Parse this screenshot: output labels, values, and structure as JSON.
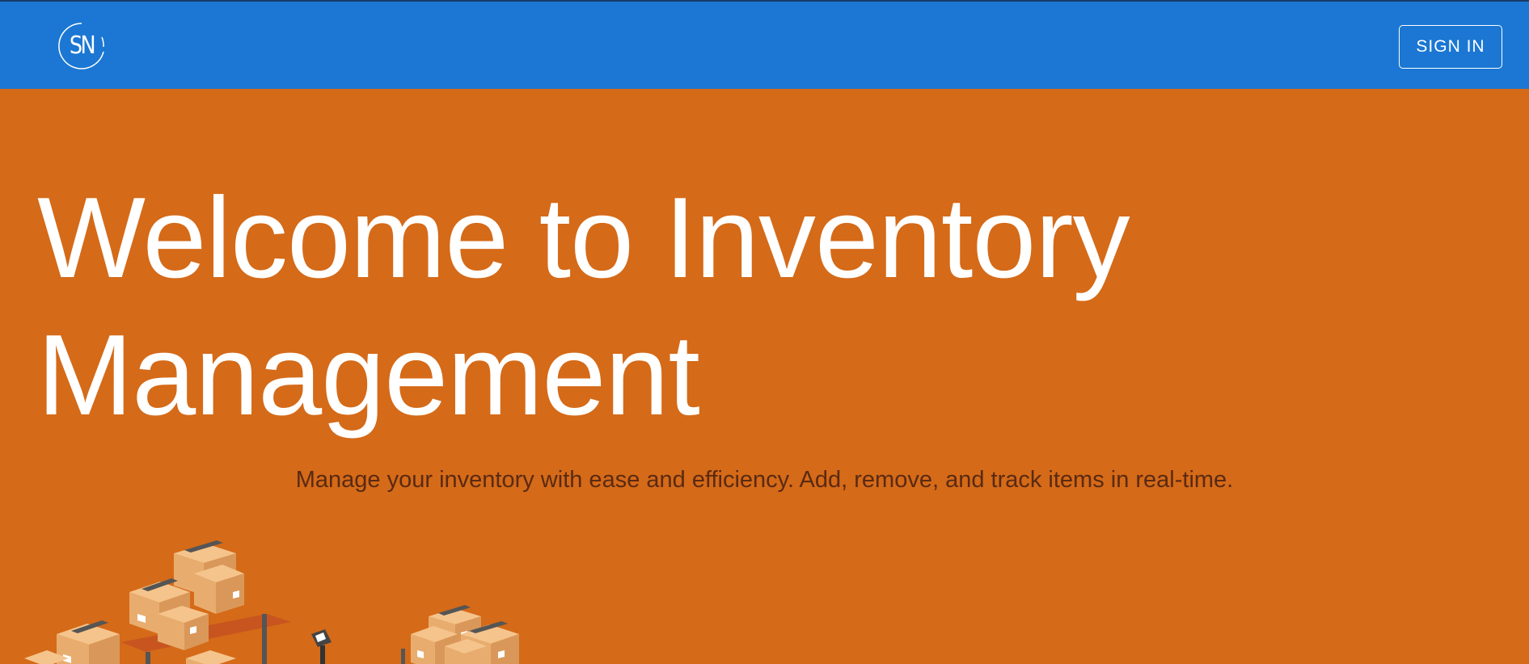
{
  "header": {
    "logo_text": "SN",
    "signin_label": "SIGN IN",
    "brand_color": "#1b77d3"
  },
  "hero": {
    "title": "Welcome to Inventory Management",
    "subtitle": "Manage your inventory with ease and efficiency. Add, remove, and track items in real-time.",
    "background_color": "#d56a18",
    "illustration": "warehouse-boxes-illustration"
  }
}
